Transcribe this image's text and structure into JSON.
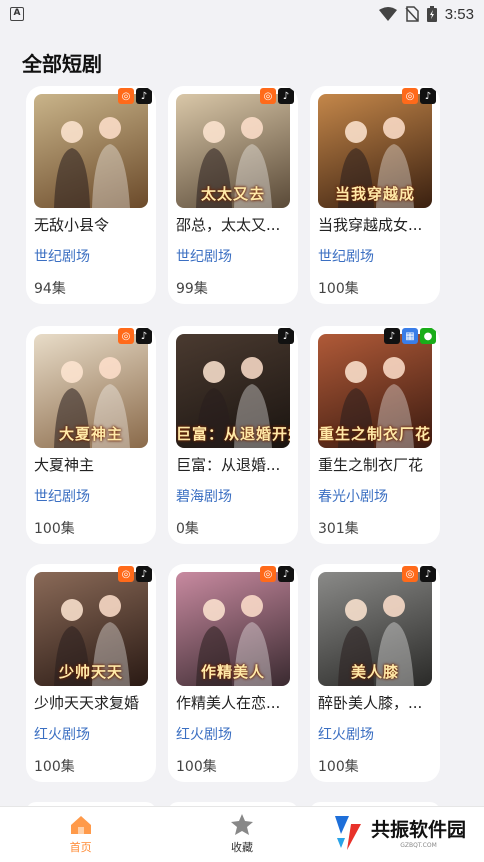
{
  "status_bar": {
    "time": "3:53"
  },
  "page": {
    "title": "全部短剧"
  },
  "dramas": [
    {
      "title": "无敌小县令",
      "source": "世纪剧场",
      "episodes": "94集",
      "poster_text": "",
      "colors": [
        "#c9b48a",
        "#6b4a2a"
      ],
      "badges": [
        "kuaishou-icon",
        "douyin-icon"
      ]
    },
    {
      "title": "邵总，太太又...",
      "source": "世纪剧场",
      "episodes": "99集",
      "poster_text": "太太又去",
      "colors": [
        "#d9c7a8",
        "#5a4a38"
      ],
      "badges": [
        "kuaishou-icon",
        "douyin-icon"
      ]
    },
    {
      "title": "当我穿越成女...",
      "source": "世纪剧场",
      "episodes": "100集",
      "poster_text": "当我穿越成",
      "colors": [
        "#c4874a",
        "#3a2010"
      ],
      "badges": [
        "kuaishou-icon",
        "douyin-icon"
      ]
    },
    {
      "title": "大夏神主",
      "source": "世纪剧场",
      "episodes": "100集",
      "poster_text": "大夏神主",
      "colors": [
        "#e8dcc8",
        "#8a6a4a"
      ],
      "badges": [
        "kuaishou-icon",
        "douyin-icon"
      ]
    },
    {
      "title": "巨富：从退婚...",
      "source": "碧海剧场",
      "episodes": "0集",
      "poster_text": "巨富：从退婚开始",
      "colors": [
        "#4a3a30",
        "#1a1410"
      ],
      "badges": [
        "douyin-icon"
      ]
    },
    {
      "title": "重生之制衣厂花",
      "source": "春光小剧场",
      "episodes": "301集",
      "poster_text": "重生之制衣厂花",
      "colors": [
        "#b05a38",
        "#3a1a10"
      ],
      "badges": [
        "douyin-icon",
        "qrcode-icon",
        "wechat-icon"
      ]
    },
    {
      "title": "少帅天天求复婚",
      "source": "红火剧场",
      "episodes": "100集",
      "poster_text": "少帅天天",
      "colors": [
        "#8a6a58",
        "#2a1a14"
      ],
      "badges": [
        "kuaishou-icon",
        "douyin-icon"
      ]
    },
    {
      "title": "作精美人在恋...",
      "source": "红火剧场",
      "episodes": "100集",
      "poster_text": "作精美人",
      "colors": [
        "#c88aa0",
        "#3a2a30"
      ],
      "badges": [
        "kuaishou-icon",
        "douyin-icon"
      ]
    },
    {
      "title": "醉卧美人膝，...",
      "source": "红火剧场",
      "episodes": "100集",
      "poster_text": "美人膝",
      "colors": [
        "#8a8a88",
        "#2a2a28"
      ],
      "badges": [
        "kuaishou-icon",
        "douyin-icon"
      ]
    }
  ],
  "nav": {
    "home_label": "首页",
    "favorites_label": "收藏"
  },
  "watermark": {
    "text": "共振软件园",
    "sub": "GZBQT.COM"
  },
  "colors": {
    "accent": "#ff8a33",
    "source_link": "#3b6fc2",
    "background": "#f2f2f5"
  }
}
